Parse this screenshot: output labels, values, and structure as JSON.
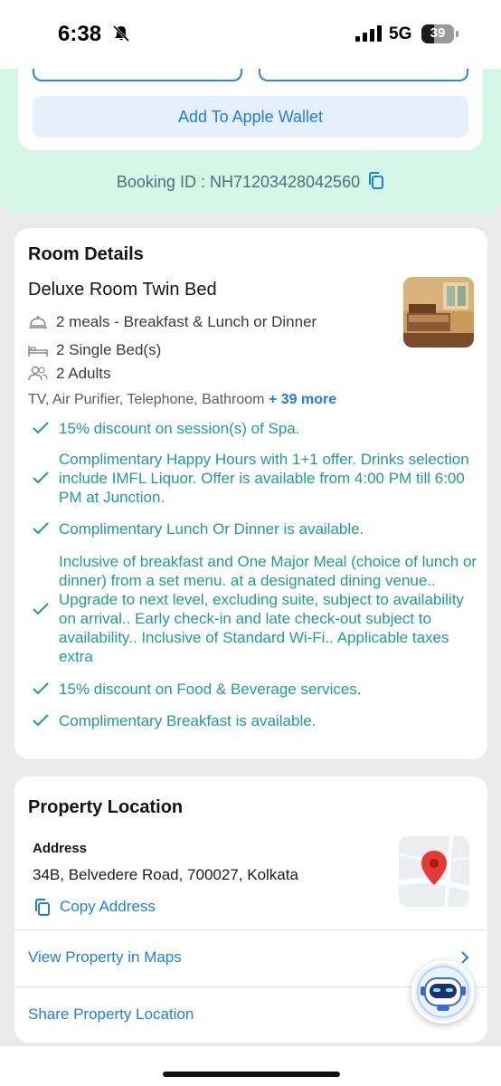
{
  "status_bar": {
    "time": "6:38",
    "network": "5G",
    "battery_level": 39,
    "battery_text": "39"
  },
  "wallet": {
    "add_wallet_label": "Add To Apple Wallet"
  },
  "booking": {
    "label": "Booking ID : NH71203428042560"
  },
  "room_details": {
    "title": "Room Details",
    "room_name": "Deluxe Room Twin Bed",
    "meals": "2 meals - Breakfast & Lunch or Dinner",
    "beds": "2 Single Bed(s)",
    "guests": "2 Adults",
    "amenities": "TV, Air Purifier, Telephone, Bathroom",
    "amenities_more": "+ 39 more",
    "inclusions": [
      "15% discount on session(s) of Spa.",
      "Complimentary Happy Hours with 1+1 offer. Drinks selection include IMFL Liquor. Offer is available from 4:00 PM till 6:00 PM at Junction.",
      "Complimentary  Lunch Or Dinner is available.",
      "Inclusive of breakfast and One Major Meal (choice of lunch or dinner) from a set menu. at a designated dining venue.. Upgrade to next level, excluding suite, subject to availability on arrival.. Early check-in and late check-out subject to availability.. Inclusive of Standard Wi-Fi.. Applicable taxes extra",
      "15% discount on Food & Beverage services.",
      "Complimentary  Breakfast is available."
    ]
  },
  "property_location": {
    "title": "Property Location",
    "address_label": "Address",
    "address_value": "34B, Belvedere Road, 700027, Kolkata",
    "copy_address_label": "Copy Address",
    "view_in_maps_label": "View Property in Maps",
    "share_location_label": "Share Property Location"
  },
  "colors": {
    "accent": "#1f80d9",
    "inclusion_green": "#1e9d8f",
    "mint_band": "#d5f5e7",
    "map_pin": "#e53935"
  }
}
